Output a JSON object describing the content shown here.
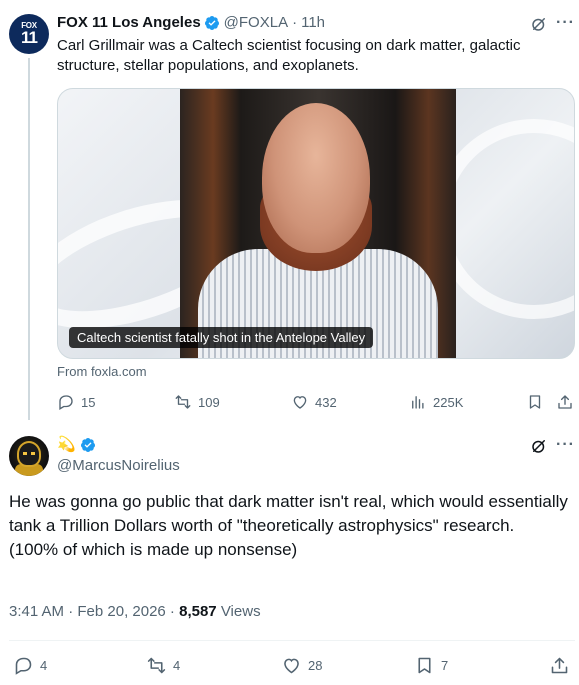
{
  "parent_tweet": {
    "avatar": {
      "line1": "FOX",
      "line2": "11"
    },
    "author_name": "FOX 11 Los Angeles",
    "handle": "@FOXLA",
    "separator": "·",
    "time": "11h",
    "text": "Carl Grillmair was a Caltech scientist focusing on dark matter, galactic structure, stellar populations, and exoplanets.",
    "card": {
      "caption": "Caltech scientist fatally shot in the Antelope Valley",
      "source": "From foxla.com"
    },
    "actions": {
      "replies": "15",
      "reposts": "109",
      "likes": "432",
      "views": "225K"
    }
  },
  "reply_tweet": {
    "emoji": "💫",
    "handle": "@MarcusNoirelius",
    "text": "He was gonna go public that dark matter isn't real, which would essentially tank a Trillion Dollars worth of \"theoretically astrophysics\" research.\n(100% of which is made up nonsense)",
    "timestamp": "3:41 AM · Feb 20, 2026 · ",
    "views_count": "8,587",
    "views_label": "Views",
    "actions": {
      "replies": "4",
      "reposts": "4",
      "likes": "28",
      "bookmarks": "7"
    }
  },
  "colors": {
    "text_primary": "#0f1419",
    "text_secondary": "#536471",
    "verified_blue": "#1d9bf0",
    "border": "#cfd9de"
  },
  "icons": [
    "fox11-avatar",
    "verified-badge-icon",
    "grok-icon",
    "more-icon",
    "reply-icon",
    "repost-icon",
    "like-icon",
    "views-icon",
    "bookmark-icon",
    "share-icon"
  ]
}
